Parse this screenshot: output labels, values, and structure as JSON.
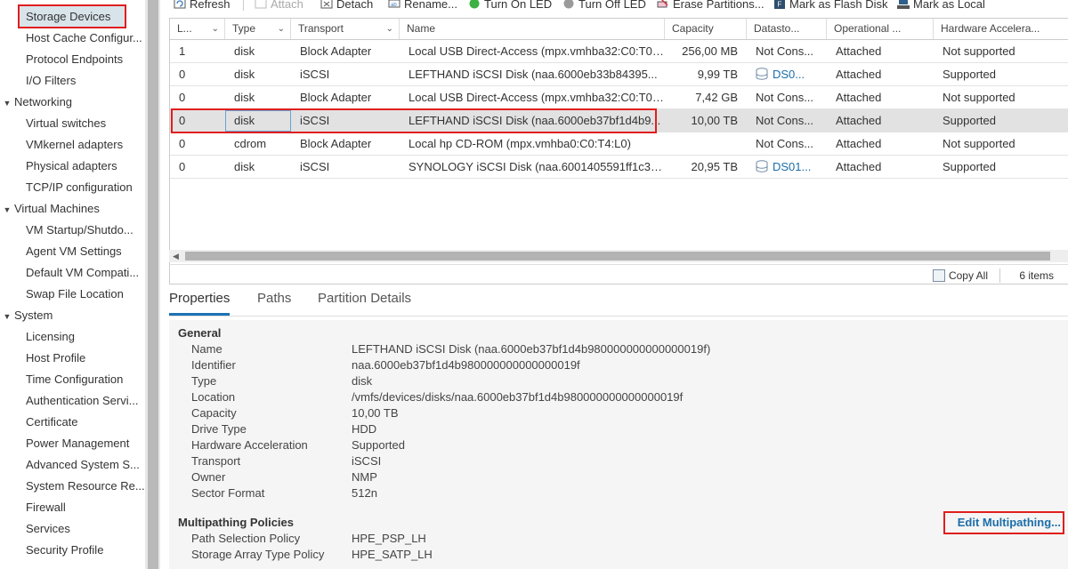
{
  "sidebar": {
    "items": [
      {
        "label": "Storage Devices",
        "type": "item",
        "selected": true
      },
      {
        "label": "Host Cache Configur...",
        "type": "item"
      },
      {
        "label": "Protocol Endpoints",
        "type": "item"
      },
      {
        "label": "I/O Filters",
        "type": "item"
      },
      {
        "label": "Networking",
        "type": "group"
      },
      {
        "label": "Virtual switches",
        "type": "item"
      },
      {
        "label": "VMkernel adapters",
        "type": "item"
      },
      {
        "label": "Physical adapters",
        "type": "item"
      },
      {
        "label": "TCP/IP configuration",
        "type": "item"
      },
      {
        "label": "Virtual Machines",
        "type": "group"
      },
      {
        "label": "VM Startup/Shutdo...",
        "type": "item"
      },
      {
        "label": "Agent VM Settings",
        "type": "item"
      },
      {
        "label": "Default VM Compati...",
        "type": "item"
      },
      {
        "label": "Swap File Location",
        "type": "item"
      },
      {
        "label": "System",
        "type": "group"
      },
      {
        "label": "Licensing",
        "type": "item"
      },
      {
        "label": "Host Profile",
        "type": "item"
      },
      {
        "label": "Time Configuration",
        "type": "item"
      },
      {
        "label": "Authentication Servi...",
        "type": "item"
      },
      {
        "label": "Certificate",
        "type": "item"
      },
      {
        "label": "Power Management",
        "type": "item"
      },
      {
        "label": "Advanced System S...",
        "type": "item"
      },
      {
        "label": "System Resource Re...",
        "type": "item"
      },
      {
        "label": "Firewall",
        "type": "item"
      },
      {
        "label": "Services",
        "type": "item"
      },
      {
        "label": "Security Profile",
        "type": "item"
      }
    ]
  },
  "toolbar": {
    "refresh": "Refresh",
    "attach": "Attach",
    "detach": "Detach",
    "rename": "Rename...",
    "turn_on_led": "Turn On LED",
    "turn_off_led": "Turn Off LED",
    "erase_partitions": "Erase Partitions...",
    "mark_flash": "Mark as Flash Disk",
    "mark_local": "Mark as Local"
  },
  "grid": {
    "columns": [
      "L...",
      "Type",
      "Transport",
      "Name",
      "Capacity",
      "Datasto...",
      "Operational ...",
      "Hardware Accelera..."
    ],
    "rows": [
      {
        "lun": "1",
        "type": "disk",
        "transport": "Block Adapter",
        "name": "Local USB Direct-Access (mpx.vmhba32:C0:T0:...",
        "capacity": "256,00 MB",
        "datastore": "Not Cons...",
        "ds_link": false,
        "operational": "Attached",
        "hw_accel": "Not supported"
      },
      {
        "lun": "0",
        "type": "disk",
        "transport": "iSCSI",
        "name": "LEFTHAND iSCSI Disk (naa.6000eb33b84395...",
        "capacity": "9,99 TB",
        "datastore": "DS0...",
        "ds_link": true,
        "operational": "Attached",
        "hw_accel": "Supported"
      },
      {
        "lun": "0",
        "type": "disk",
        "transport": "Block Adapter",
        "name": "Local USB Direct-Access (mpx.vmhba32:C0:T0:...",
        "capacity": "7,42 GB",
        "datastore": "Not Cons...",
        "ds_link": false,
        "operational": "Attached",
        "hw_accel": "Not supported"
      },
      {
        "lun": "0",
        "type": "disk",
        "transport": "iSCSI",
        "name": "LEFTHAND iSCSI Disk (naa.6000eb37bf1d4b9...",
        "capacity": "10,00 TB",
        "datastore": "Not Cons...",
        "ds_link": false,
        "operational": "Attached",
        "hw_accel": "Supported",
        "selected": true
      },
      {
        "lun": "0",
        "type": "cdrom",
        "transport": "Block Adapter",
        "name": "Local hp CD-ROM (mpx.vmhba0:C0:T4:L0)",
        "capacity": "",
        "datastore": "Not Cons...",
        "ds_link": false,
        "operational": "Attached",
        "hw_accel": "Not supported"
      },
      {
        "lun": "0",
        "type": "disk",
        "transport": "iSCSI",
        "name": "SYNOLOGY iSCSI Disk (naa.6001405591ff1c3d...",
        "capacity": "20,95 TB",
        "datastore": "DS01...",
        "ds_link": true,
        "operational": "Attached",
        "hw_accel": "Supported"
      }
    ],
    "copy_all": "Copy All",
    "items_count": "6 items"
  },
  "tabs": [
    "Properties",
    "Paths",
    "Partition Details"
  ],
  "properties": {
    "general_title": "General",
    "general": [
      {
        "label": "Name",
        "value": "LEFTHAND iSCSI Disk (naa.6000eb37bf1d4b980000000000000019f)"
      },
      {
        "label": "Identifier",
        "value": "naa.6000eb37bf1d4b980000000000000019f"
      },
      {
        "label": "Type",
        "value": "disk"
      },
      {
        "label": "Location",
        "value": "/vmfs/devices/disks/naa.6000eb37bf1d4b980000000000000019f"
      },
      {
        "label": "Capacity",
        "value": "10,00 TB"
      },
      {
        "label": "Drive Type",
        "value": "HDD"
      },
      {
        "label": "Hardware Acceleration",
        "value": "Supported"
      },
      {
        "label": "Transport",
        "value": "iSCSI"
      },
      {
        "label": "Owner",
        "value": "NMP"
      },
      {
        "label": "Sector Format",
        "value": "512n"
      }
    ],
    "multipath_title": "Multipathing Policies",
    "multipath": [
      {
        "label": "Path Selection Policy",
        "value": "HPE_PSP_LH"
      },
      {
        "label": "Storage Array Type Policy",
        "value": "HPE_SATP_LH"
      }
    ],
    "edit_multipathing": "Edit Multipathing..."
  },
  "colors": {
    "accent": "#1a73b6",
    "link": "#1b6ea9",
    "highlight": "#e01e1e",
    "selected_row": "#e2e2e2"
  }
}
